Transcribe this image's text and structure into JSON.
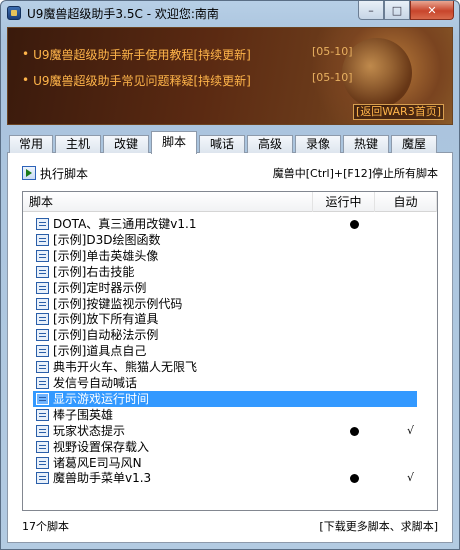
{
  "window": {
    "title": "U9魔兽超级助手3.5C - 欢迎您:南南",
    "min": "–",
    "max": "□",
    "close": "✕"
  },
  "banner": {
    "news": [
      {
        "text": "U9魔兽超级助手新手使用教程[持续更新]",
        "date": "[05-10]"
      },
      {
        "text": "U9魔兽超级助手常见问题释疑[持续更新]",
        "date": "[05-10]"
      }
    ],
    "home_link": "[返回WAR3首页]"
  },
  "tabs": [
    "常用",
    "主机",
    "改键",
    "脚本",
    "喊话",
    "高级",
    "录像",
    "热键",
    "魔屋"
  ],
  "active_tab": 3,
  "toolbar": {
    "run_label": "执行脚本",
    "hint": "魔兽中[Ctrl]+[F12]停止所有脚本"
  },
  "list": {
    "headers": {
      "script": "脚本",
      "running": "运行中",
      "auto": "自动"
    },
    "rows": [
      {
        "name": "DOTA、真三通用改键v1.1",
        "running": true,
        "auto": false
      },
      {
        "name": "[示例]D3D绘图函数",
        "running": false,
        "auto": false
      },
      {
        "name": "[示例]单击英雄头像",
        "running": false,
        "auto": false
      },
      {
        "name": "[示例]右击技能",
        "running": false,
        "auto": false
      },
      {
        "name": "[示例]定时器示例",
        "running": false,
        "auto": false
      },
      {
        "name": "[示例]按键监视示例代码",
        "running": false,
        "auto": false
      },
      {
        "name": "[示例]放下所有道具",
        "running": false,
        "auto": false
      },
      {
        "name": "[示例]自动秘法示例",
        "running": false,
        "auto": false
      },
      {
        "name": "[示例]道具点自己",
        "running": false,
        "auto": false
      },
      {
        "name": "典韦开火车、熊猫人无限飞",
        "running": false,
        "auto": false
      },
      {
        "name": "发信号自动喊话",
        "running": false,
        "auto": false
      },
      {
        "name": "显示游戏运行时间",
        "running": false,
        "auto": false,
        "selected": true
      },
      {
        "name": "棒子围英雄",
        "running": false,
        "auto": false
      },
      {
        "name": "玩家状态提示",
        "running": true,
        "auto": true
      },
      {
        "name": "视野设置保存载入",
        "running": false,
        "auto": false
      },
      {
        "name": "诸葛风E司马风N",
        "running": false,
        "auto": false
      },
      {
        "name": "魔兽助手菜单v1.3",
        "running": true,
        "auto": true
      }
    ],
    "check_mark": "√"
  },
  "footer": {
    "count": "17个脚本",
    "more_link": "[下载更多脚本、求脚本]"
  }
}
